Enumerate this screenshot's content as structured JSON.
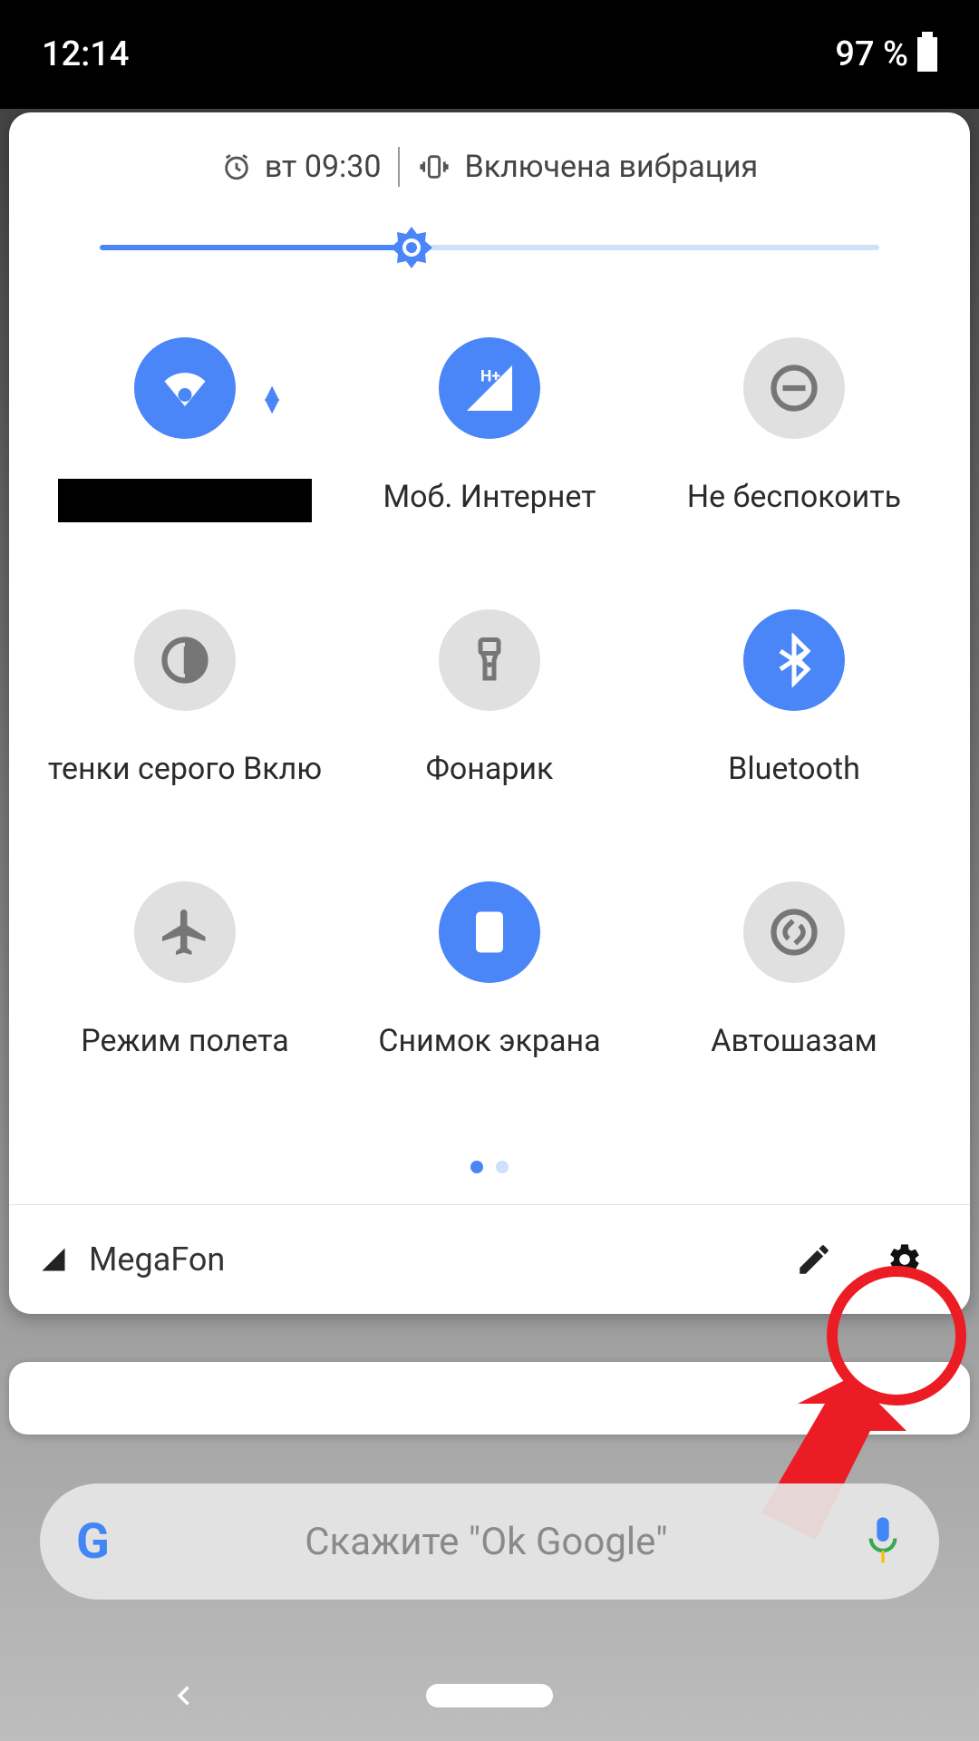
{
  "statusbar": {
    "time": "12:14",
    "battery_pct": "97 %"
  },
  "header": {
    "alarm": "вт 09:30",
    "ring_mode": "Включена вибрация"
  },
  "brightness_pct": 40,
  "tiles": [
    {
      "id": "wifi",
      "label": "",
      "on": true,
      "redacted": true
    },
    {
      "id": "mobiledata",
      "label": "Моб. Интернет",
      "on": true,
      "sub": "H+"
    },
    {
      "id": "dnd",
      "label": "Не беспокоить",
      "on": false
    },
    {
      "id": "grayscale",
      "label": "тенки серого Вклю",
      "on": false
    },
    {
      "id": "torch",
      "label": "Фонарик",
      "on": false
    },
    {
      "id": "bluetooth",
      "label": "Bluetooth",
      "on": true
    },
    {
      "id": "airplane",
      "label": "Режим полета",
      "on": false
    },
    {
      "id": "screenshot",
      "label": "Снимок экрана",
      "on": true
    },
    {
      "id": "shazam",
      "label": "Автошазам",
      "on": false
    }
  ],
  "pages": {
    "count": 2,
    "active": 0
  },
  "footer": {
    "carrier": "MegaFon"
  },
  "google": {
    "hint": "Скажите \"Ok Google\""
  }
}
